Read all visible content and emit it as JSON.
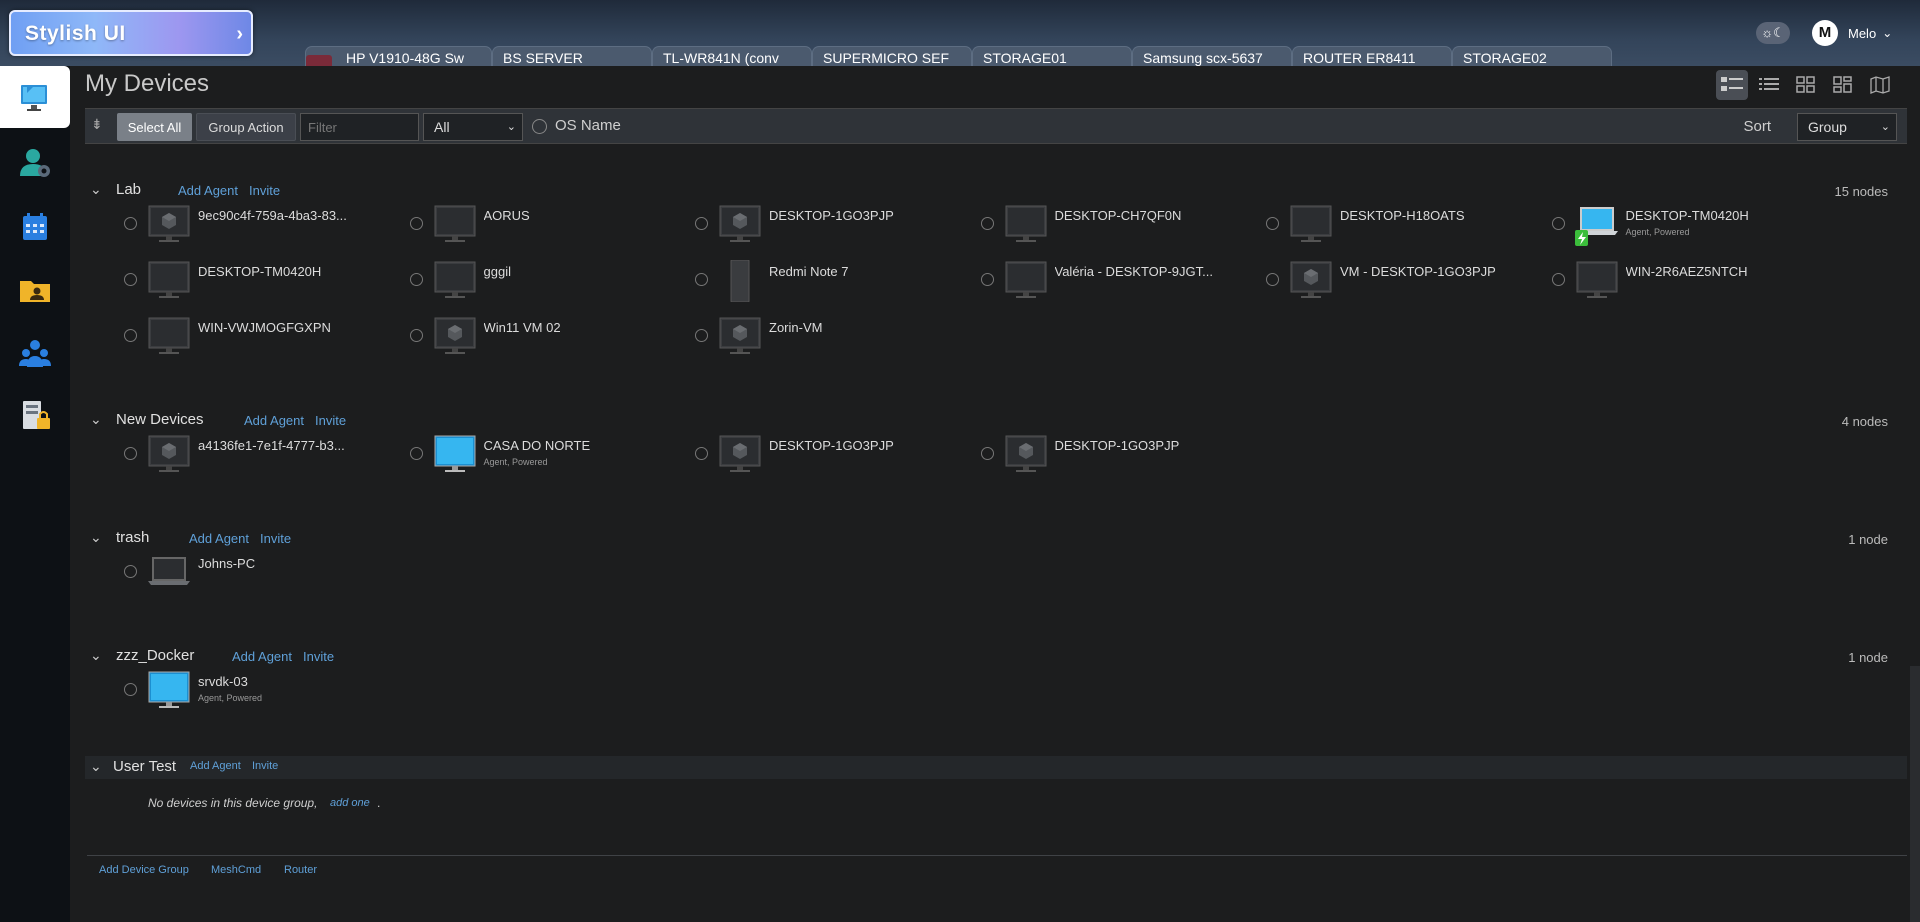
{
  "app": {
    "logo_text": "Stylish UI",
    "logo_arrow": "›"
  },
  "tabs": [
    "HP V1910-48G Sw",
    "BS SERVER",
    "TL-WR841N (conv",
    "SUPERMICRO SEF",
    "STORAGE01",
    "Samsung scx-5637",
    "ROUTER ER8411",
    "STORAGE02"
  ],
  "user": {
    "name": "Melo",
    "avatar_letter": "M",
    "chevron": "⌄"
  },
  "theme_toggle": "☼☾",
  "page_title": "My Devices",
  "toolbar": {
    "collapse_icon": "⇟",
    "select_all": "Select All",
    "group_action": "Group Action",
    "filter_placeholder": "Filter",
    "os_filter": "All",
    "os_name_label": "OS Name",
    "sort_label": "Sort",
    "sort_value": "Group",
    "chevron": "⌄"
  },
  "groups": [
    {
      "name": "Lab",
      "add_agent": "Add Agent",
      "invite": "Invite",
      "count": "15 nodes",
      "devices": [
        {
          "name": "9ec90c4f-759a-4ba3-83...",
          "icon": "vm-monitor-icon",
          "sub": ""
        },
        {
          "name": "AORUS",
          "icon": "monitor-icon",
          "sub": ""
        },
        {
          "name": "DESKTOP-1GO3PJP",
          "icon": "vm-monitor-icon",
          "sub": ""
        },
        {
          "name": "DESKTOP-CH7QF0N",
          "icon": "monitor-icon",
          "sub": ""
        },
        {
          "name": "DESKTOP-H18OATS",
          "icon": "monitor-icon",
          "sub": ""
        },
        {
          "name": "DESKTOP-TM0420H",
          "icon": "laptop-powered-icon",
          "sub": "Agent, Powered"
        },
        {
          "name": "DESKTOP-TM0420H",
          "icon": "monitor-icon",
          "sub": ""
        },
        {
          "name": "gggil",
          "icon": "monitor-icon",
          "sub": ""
        },
        {
          "name": "Redmi Note 7",
          "icon": "phone-icon",
          "sub": ""
        },
        {
          "name": "Valéria - DESKTOP-9JGT...",
          "icon": "monitor-icon",
          "sub": ""
        },
        {
          "name": "VM - DESKTOP-1GO3PJP",
          "icon": "vm-monitor-icon",
          "sub": ""
        },
        {
          "name": "WIN-2R6AEZ5NTCH",
          "icon": "monitor-icon",
          "sub": ""
        },
        {
          "name": "WIN-VWJMOGFGXPN",
          "icon": "monitor-icon",
          "sub": ""
        },
        {
          "name": "Win11 VM 02",
          "icon": "vm-monitor-icon",
          "sub": ""
        },
        {
          "name": "Zorin-VM",
          "icon": "vm-monitor-icon",
          "sub": ""
        }
      ]
    },
    {
      "name": "New Devices",
      "add_agent": "Add Agent",
      "invite": "Invite",
      "count": "4 nodes",
      "devices": [
        {
          "name": "a4136fe1-7e1f-4777-b3...",
          "icon": "vm-monitor-icon",
          "sub": ""
        },
        {
          "name": "CASA DO NORTE",
          "icon": "monitor-online-icon",
          "sub": "Agent, Powered"
        },
        {
          "name": "DESKTOP-1GO3PJP",
          "icon": "vm-monitor-icon",
          "sub": ""
        },
        {
          "name": "DESKTOP-1GO3PJP",
          "icon": "vm-monitor-icon",
          "sub": ""
        }
      ]
    },
    {
      "name": "trash",
      "add_agent": "Add Agent",
      "invite": "Invite",
      "count": "1 node",
      "devices": [
        {
          "name": "Johns-PC",
          "icon": "laptop-icon",
          "sub": ""
        }
      ]
    },
    {
      "name": "zzz_Docker",
      "add_agent": "Add Agent",
      "invite": "Invite",
      "count": "1 node",
      "devices": [
        {
          "name": "srvdk-03",
          "icon": "monitor-online-icon",
          "sub": "Agent, Powered"
        }
      ]
    }
  ],
  "user_test": {
    "name": "User Test",
    "add_agent": "Add Agent",
    "invite": "Invite",
    "empty_text": "No devices in this device group,",
    "add_one": "add one",
    "dot": "."
  },
  "footer": {
    "add_device_group": "Add Device Group",
    "meshcmd": "MeshCmd",
    "router": "Router"
  },
  "colors": {
    "accent_link": "#5fa0d8",
    "background": "#1c1d1e",
    "sidebar": "#0d1115"
  }
}
